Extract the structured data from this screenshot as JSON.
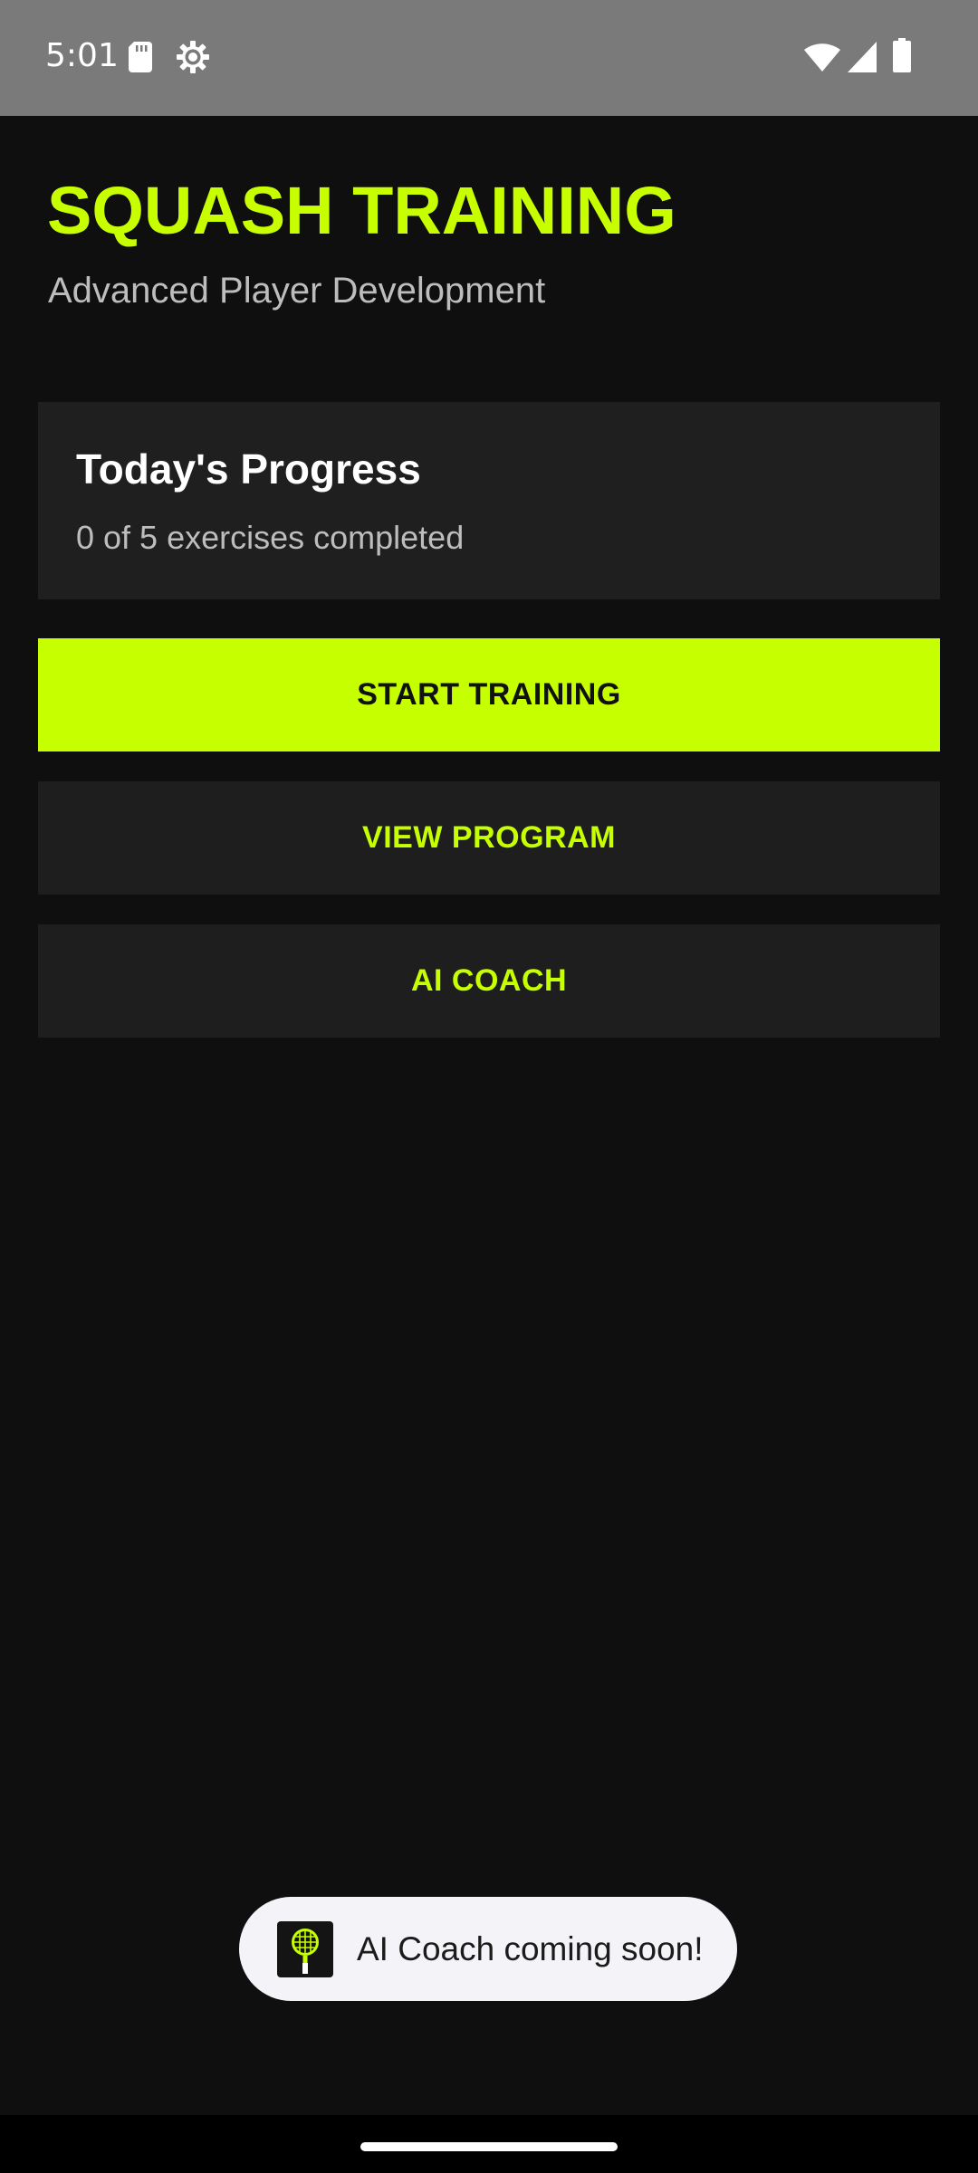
{
  "status_bar": {
    "time": "5:01",
    "icons": [
      "sd-card-icon",
      "settings-gear-icon",
      "wifi-icon",
      "cell-signal-icon",
      "battery-icon"
    ]
  },
  "header": {
    "title": "SQUASH TRAINING",
    "subtitle": "Advanced Player Development"
  },
  "progress": {
    "title": "Today's Progress",
    "summary": "0 of 5 exercises completed",
    "completed": 0,
    "total": 5
  },
  "actions": {
    "start_label": "START TRAINING",
    "program_label": "VIEW PROGRAM",
    "coach_label": "AI COACH"
  },
  "toast": {
    "message": "AI Coach coming soon!",
    "icon": "squash-racket-icon"
  },
  "colors": {
    "accent": "#c6ff00",
    "background": "#0f0f0f",
    "card": "#1f1f1f",
    "status_bar": "#7a7a7a"
  }
}
